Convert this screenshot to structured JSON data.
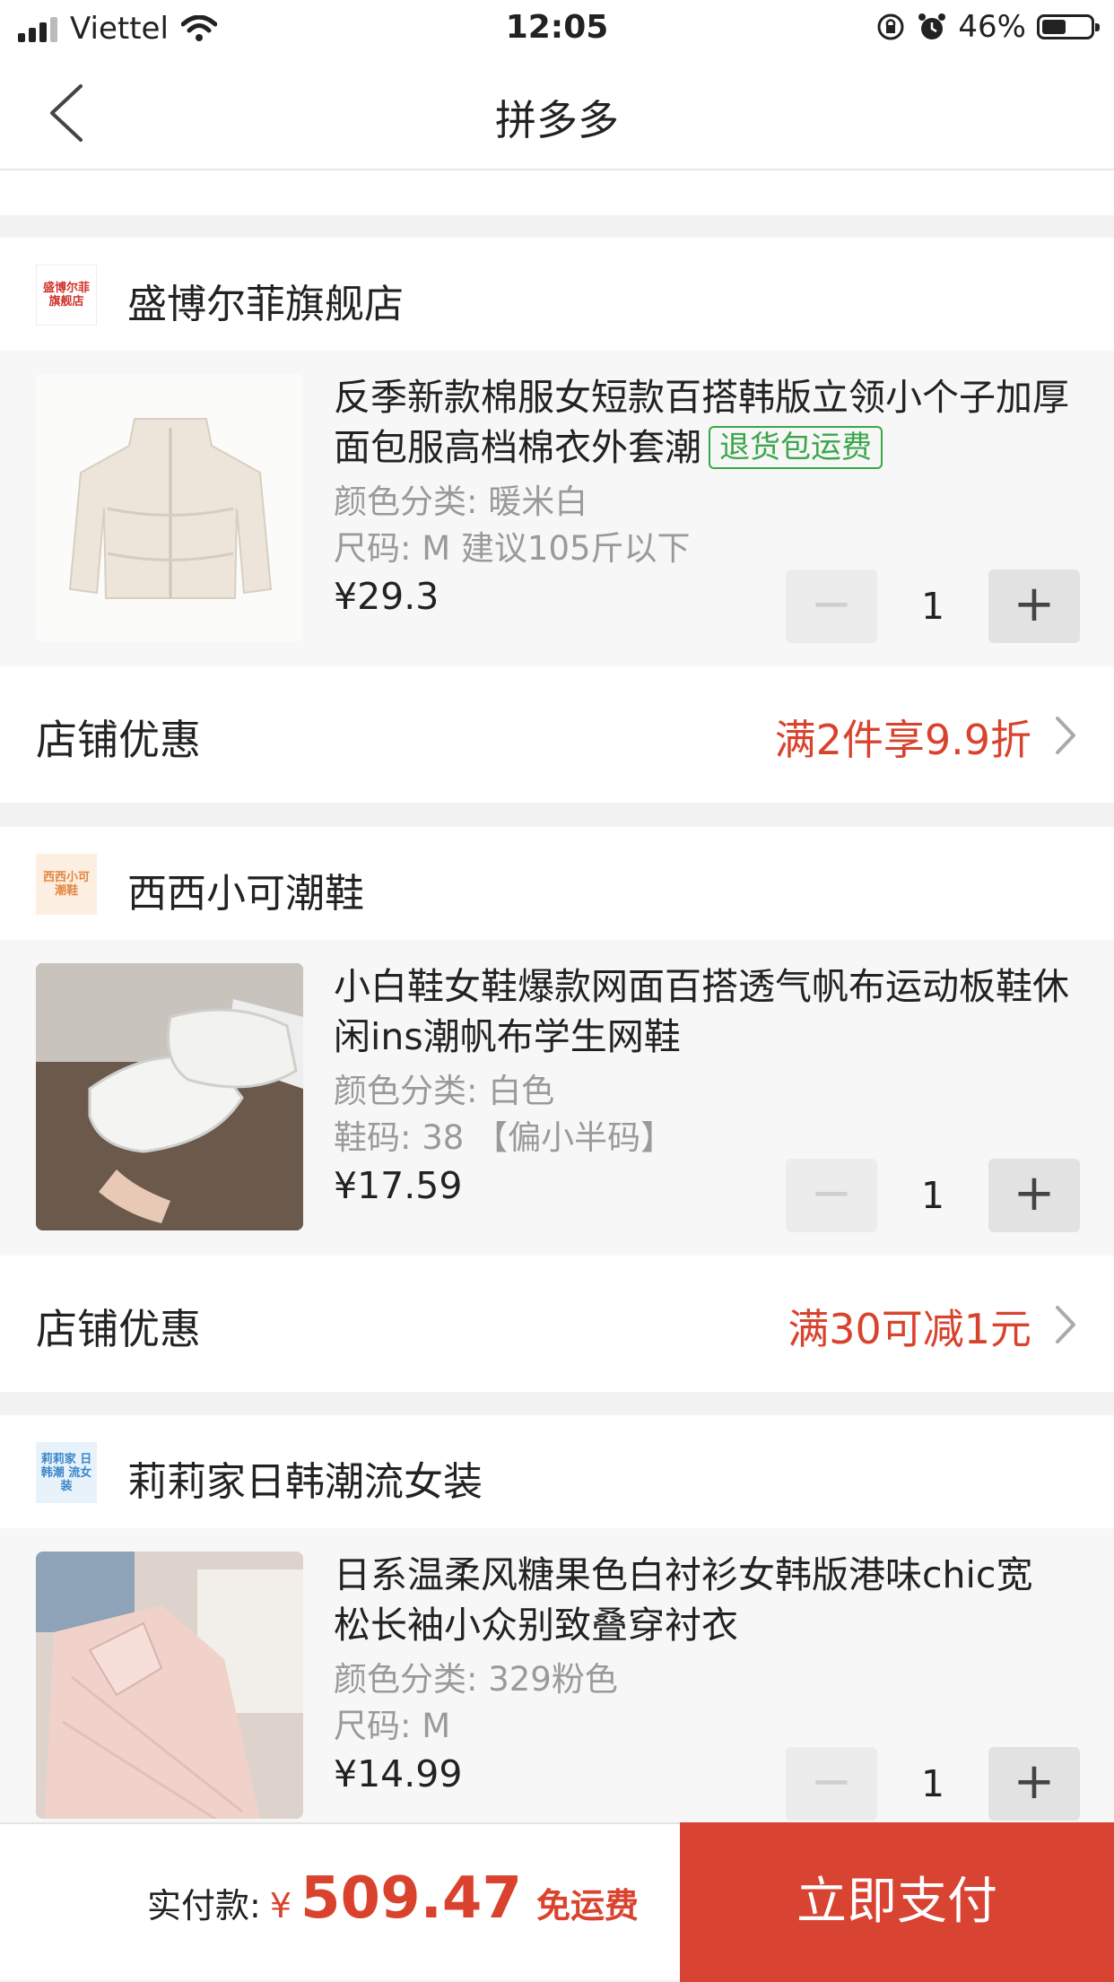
{
  "status": {
    "carrier": "Viettel",
    "time": "12:05",
    "battery": "46%",
    "battery_level": 0.46
  },
  "nav": {
    "title": "拼多多"
  },
  "stores": [
    {
      "name": "盛博尔菲旗舰店",
      "logo_text": "盛博尔菲 旗舰店",
      "product": {
        "title": "反季新款棉服女短款百搭韩版立领小个子加厚面包服高档棉衣外套潮",
        "tag": "退货包运费",
        "spec1": "颜色分类: 暖米白",
        "spec2": "尺码: M 建议105斤以下",
        "price": "¥29.3",
        "qty": "1"
      },
      "promo": {
        "label": "店铺优惠",
        "value": "满2件享9.9折"
      }
    },
    {
      "name": "西西小可潮鞋",
      "logo_text": "西西小可 潮鞋",
      "product": {
        "title": "小白鞋女鞋爆款网面百搭透气帆布运动板鞋休闲ins潮帆布学生网鞋",
        "spec1": "颜色分类: 白色",
        "spec2": "鞋码: 38 【偏小半码】",
        "price": "¥17.59",
        "qty": "1"
      },
      "promo": {
        "label": "店铺优惠",
        "value": "满30可减1元"
      }
    },
    {
      "name": "莉莉家日韩潮流女装",
      "logo_text": "莉莉家 日韩潮 流女装",
      "product": {
        "title": "日系温柔风糖果色白衬衫女韩版港味chic宽松长袖小众别致叠穿衬衣",
        "spec1": "颜色分类: 329粉色",
        "spec2": "尺码: M",
        "price": "¥14.99",
        "qty": "1"
      }
    }
  ],
  "controls": {
    "minus": "−",
    "plus": "+"
  },
  "footer": {
    "total_label": "实付款:",
    "currency": "¥",
    "total": "509.47",
    "shipping": "免运费",
    "pay_button": "立即支付"
  }
}
